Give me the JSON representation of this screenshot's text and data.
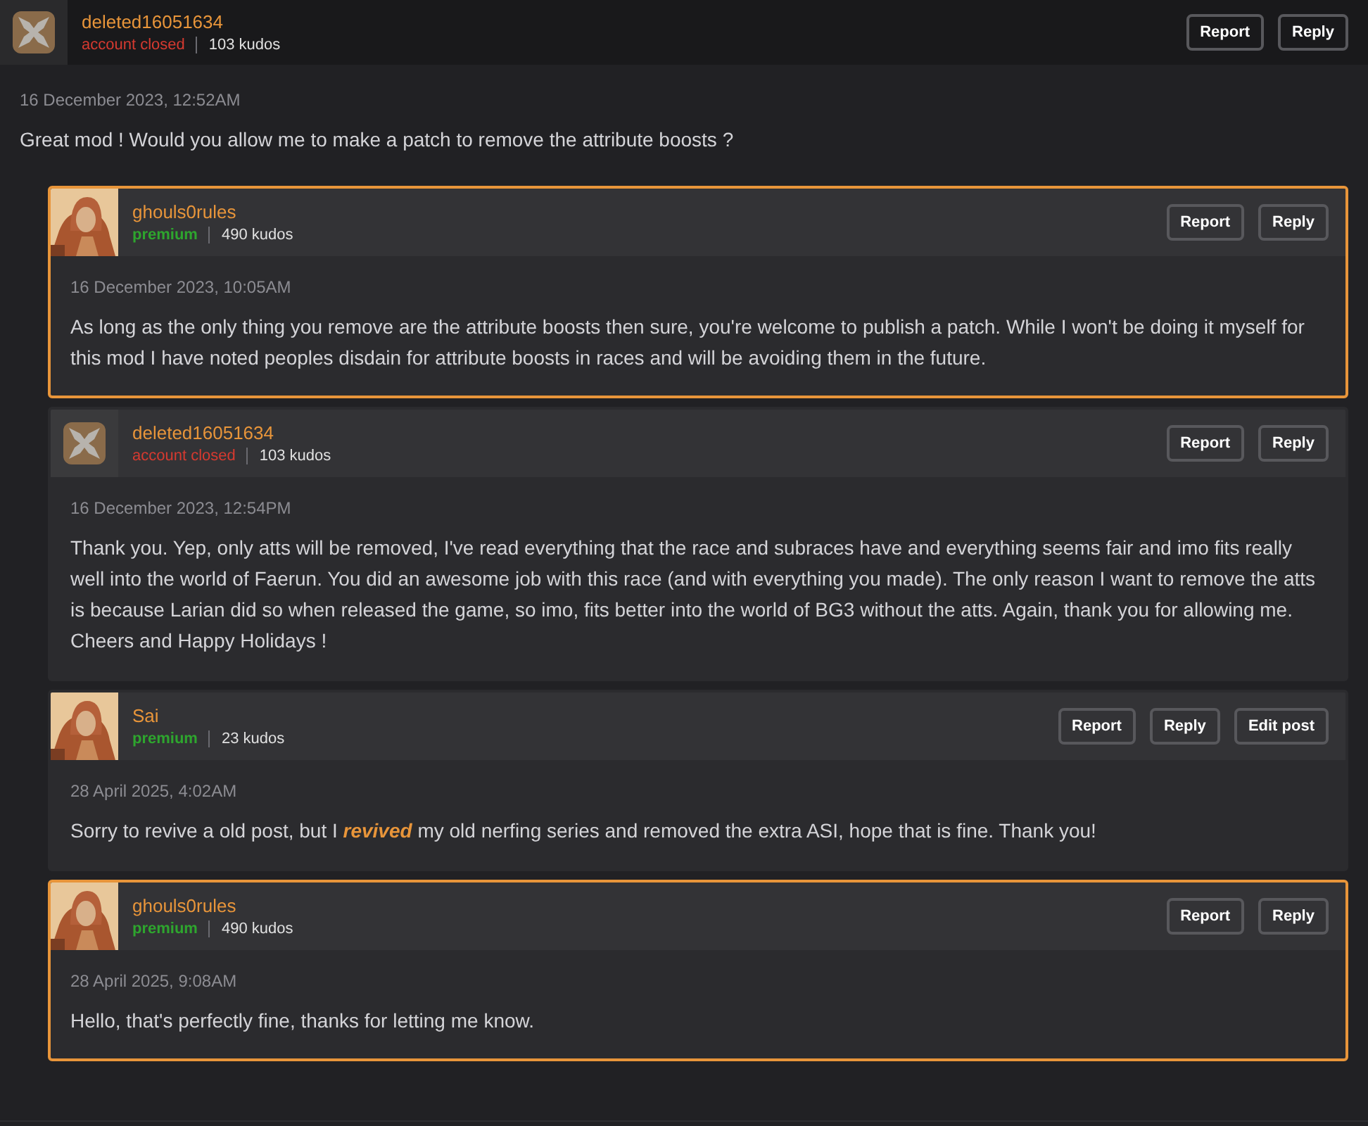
{
  "comment": {
    "author": {
      "name": "deleted16051634",
      "rank": {
        "text": "account closed",
        "kind": "closed"
      },
      "kudos": "103 kudos",
      "avatar": {
        "kind": "deleted"
      }
    },
    "buttons": [
      "Report",
      "Reply"
    ],
    "date": "16 December 2023, 12:52AM",
    "text": "Great mod ! Would you allow me to make a patch to remove the attribute boosts ?",
    "replies": [
      {
        "author": {
          "name": "ghouls0rules",
          "rank": {
            "text": "premium",
            "kind": "premium"
          },
          "kudos": "490 kudos"
        },
        "highlighted": true,
        "buttons": [
          "Report",
          "Reply"
        ],
        "date": "16 December 2023, 10:05AM",
        "text": "As long as the only thing you remove are the attribute boosts then sure, you're welcome to publish a patch. While I won't be doing it myself for this mod I have noted peoples disdain for attribute boosts in races and will be avoiding them in the future."
      },
      {
        "author": {
          "name": "deleted16051634",
          "rank": {
            "text": "account closed",
            "kind": "closed"
          },
          "kudos": "103 kudos",
          "avatar": {
            "kind": "deleted"
          }
        },
        "highlighted": false,
        "buttons": [
          "Report",
          "Reply"
        ],
        "date": "16 December 2023, 12:54PM",
        "text": "Thank you. Yep, only atts will be removed, I've read everything that the race and subraces have and everything seems fair and imo fits really well into the world of Faerun. You did an awesome job with this race (and with everything you made). The only reason I want to remove the atts is because Larian did so when released the game, so imo, fits better into the world of BG3 without the atts. Again, thank you for allowing me. Cheers and Happy Holidays !"
      },
      {
        "author": {
          "name": "Sai",
          "rank": {
            "text": "premium",
            "kind": "premium"
          },
          "kudos": "23 kudos"
        },
        "highlighted": false,
        "buttons": [
          "Report",
          "Reply",
          "Edit post"
        ],
        "date": "28 April 2025, 4:02AM",
        "text": "Sorry to revive a old post, but I *revived* my old nerfing series and removed the extra ASI, hope that is fine. Thank you!"
      },
      {
        "author": {
          "name": "ghouls0rules",
          "rank": {
            "text": "premium",
            "kind": "premium"
          },
          "kudos": "490 kudos"
        },
        "highlighted": true,
        "buttons": [
          "Report",
          "Reply"
        ],
        "date": "28 April 2025, 9:08AM",
        "text": "Hello, that's perfectly fine, thanks for letting me know."
      }
    ]
  }
}
